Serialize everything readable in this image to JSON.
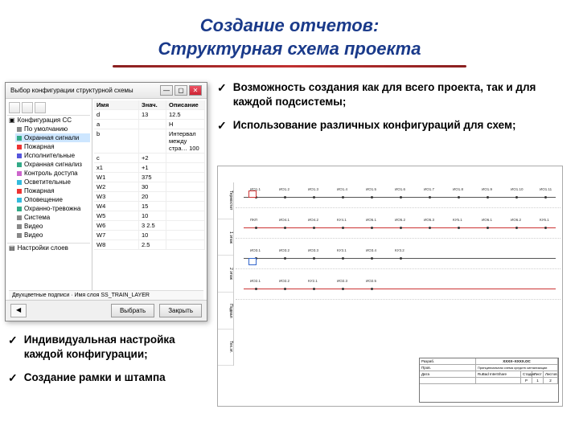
{
  "header": {
    "line1": "Создание отчетов:",
    "line2": "Структурная схема проекта"
  },
  "bullets_upper": [
    "Возможность создания как для всего проекта, так и для каждой подсистемы;",
    "Использование различных конфигураций для схем;"
  ],
  "bullets_lower": [
    "Индивидуальная настройка каждой конфигурации;",
    "Создание рамки и штампа"
  ],
  "dialog": {
    "title": "Выбор конфигурации структурной схемы",
    "tree": {
      "root": "Конфигурация СС",
      "items": [
        {
          "label": "По умолчанию",
          "color": "#888"
        },
        {
          "label": "Охранная сигнали",
          "color": "#3a8",
          "selected": true
        },
        {
          "label": "Пожарная",
          "color": "#e33"
        },
        {
          "label": "Исполнительные",
          "color": "#55d"
        },
        {
          "label": "Охранная сигнализ",
          "color": "#3a8"
        },
        {
          "label": "Контроль доступа",
          "color": "#c6c"
        },
        {
          "label": "Осветительные",
          "color": "#3bd"
        },
        {
          "label": "Пожарная",
          "color": "#e33"
        },
        {
          "label": "Оповещение",
          "color": "#3bd"
        },
        {
          "label": "Охранно-тревожна",
          "color": "#3a8"
        },
        {
          "label": "Система",
          "color": "#888"
        },
        {
          "label": "Видео",
          "color": "#888"
        },
        {
          "label": "Видео",
          "color": "#888"
        }
      ],
      "bottom_section": "Настройки слоев",
      "footer_hint": "Двухцветные подписи · Имя слоя SS_TRAIN_LAYER"
    },
    "grid": {
      "cols": [
        "Имя",
        "Знач.",
        "Описание"
      ],
      "rows": [
        [
          "d",
          "13",
          "12.5"
        ],
        [
          "a",
          "",
          "Н"
        ],
        [
          "b",
          "",
          "Интервал между стра… 100"
        ],
        [
          "c",
          "+2",
          ""
        ],
        [
          "x1",
          "+1",
          ""
        ],
        [
          "W1",
          "375",
          ""
        ],
        [
          "W2",
          "30",
          ""
        ],
        [
          "W3",
          "20",
          ""
        ],
        [
          "W4",
          "15",
          ""
        ],
        [
          "W5",
          "10",
          ""
        ],
        [
          "W6",
          "3 2.5",
          ""
        ],
        [
          "W7",
          "10",
          ""
        ],
        [
          "W8",
          "2.5",
          ""
        ]
      ]
    },
    "buttons": {
      "ok": "Выбрать",
      "cancel": "Закрыть"
    }
  },
  "diagram": {
    "side_labels": [
      "Термостат",
      "1 этаж",
      "2 этаж",
      "Подвал",
      "Тех.эт."
    ],
    "floor_labels": [
      [
        "ИО1.1",
        "ИО1.2",
        "ИО1.3",
        "ИО1.4",
        "ИО1.5",
        "ИО1.6",
        "ИО1.7",
        "ИО1.8",
        "ИО1.9",
        "ИО1.10",
        "ИО1.11"
      ],
      [
        "ПКП",
        "ИО4.1",
        "ИО4.2",
        "КУ4.1",
        "ИО5.1",
        "ИО5.2",
        "ИО5.3",
        "КУ5.1",
        "ИО6.1",
        "ИО6.2",
        "КУ6.1"
      ],
      [
        "ИО3.1",
        "ИО3.2",
        "ИО3.3",
        "КУ3.1",
        "ИО3.4",
        "КУ3.2"
      ],
      [
        "ИО2.1",
        "ИО2.2",
        "КУ2.1",
        "ИО2.3",
        "ИО2.5"
      ]
    ],
    "title_block": {
      "project": "ХХХХ–ХХХХ.ОС",
      "desc": "Принципиальная схема средств сигнализации",
      "sheet_label": "Лист",
      "sheets_label": "Листов",
      "sheet": "1",
      "sheets": "2",
      "stage": "Стадия",
      "stage_val": "Р",
      "company": "RuBad InterShare",
      "date": "Дата",
      "chk": "Пров.",
      "dev": "Разраб."
    }
  }
}
